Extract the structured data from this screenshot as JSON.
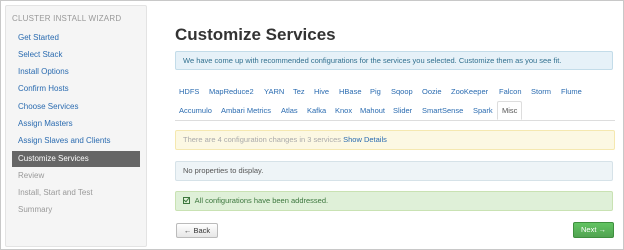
{
  "sidebar": {
    "title": "CLUSTER INSTALL WIZARD",
    "items": [
      {
        "label": "Get Started",
        "state": "link"
      },
      {
        "label": "Select Stack",
        "state": "link"
      },
      {
        "label": "Install Options",
        "state": "link"
      },
      {
        "label": "Confirm Hosts",
        "state": "link"
      },
      {
        "label": "Choose Services",
        "state": "link"
      },
      {
        "label": "Assign Masters",
        "state": "link"
      },
      {
        "label": "Assign Slaves and Clients",
        "state": "link"
      },
      {
        "label": "Customize Services",
        "state": "active"
      },
      {
        "label": "Review",
        "state": "disabled"
      },
      {
        "label": "Install, Start and Test",
        "state": "disabled"
      },
      {
        "label": "Summary",
        "state": "disabled"
      }
    ]
  },
  "main": {
    "title": "Customize Services",
    "info_text": "We have come up with recommended configurations for the services you selected. Customize them as you see fit.",
    "tabs": [
      "HDFS",
      "MapReduce2",
      "YARN",
      "Tez",
      "Hive",
      "HBase",
      "Pig",
      "Sqoop",
      "Oozie",
      "ZooKeeper",
      "Falcon",
      "Storm",
      "Flume",
      "Accumulo",
      "Ambari Metrics",
      "Atlas",
      "Kafka",
      "Knox",
      "Mahout",
      "Slider",
      "SmartSense",
      "Spark",
      "Misc"
    ],
    "active_tab": "Misc",
    "warning_text": "There are 4 configuration changes in 3 services",
    "warning_link": "Show Details",
    "empty_text": "No properties to display.",
    "success_text": "All configurations have been addressed.",
    "back_label": "← Back",
    "next_label": "Next →"
  },
  "colors": {
    "link": "#2a6bb0",
    "active_sidebar": "#666666",
    "next_button": "#51a351",
    "success_bg": "#dff0d8",
    "warning_bg": "#fcf8e3",
    "info_bg": "#e6f1f8"
  },
  "icons": {
    "success": "check-square-icon"
  }
}
